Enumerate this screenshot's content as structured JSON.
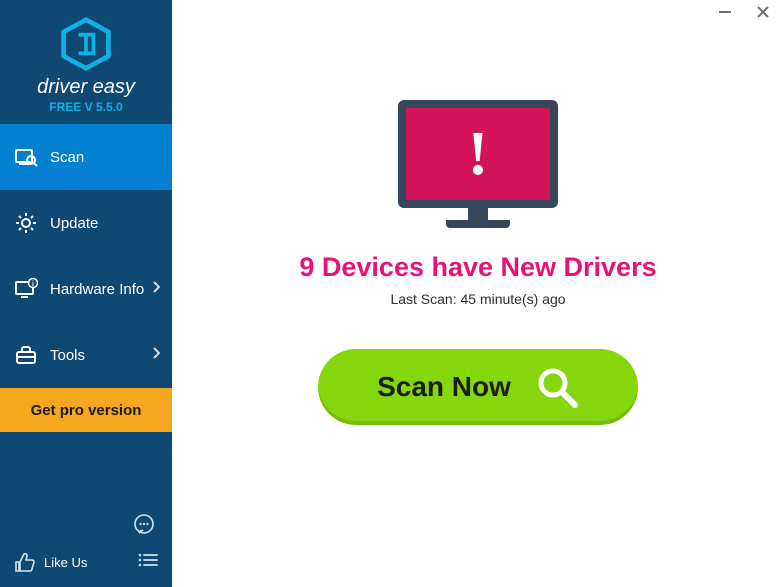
{
  "brand": {
    "name": "driver easy",
    "version_prefix": "FREE V ",
    "version": "5.5.0"
  },
  "nav": {
    "scan": "Scan",
    "update": "Update",
    "hardware": "Hardware Info",
    "tools": "Tools",
    "pro": "Get pro version"
  },
  "bottom": {
    "like": "Like Us"
  },
  "hero": {
    "headline": "9 Devices have New Drivers",
    "subline": "Last Scan: 45 minute(s) ago",
    "button": "Scan Now"
  }
}
